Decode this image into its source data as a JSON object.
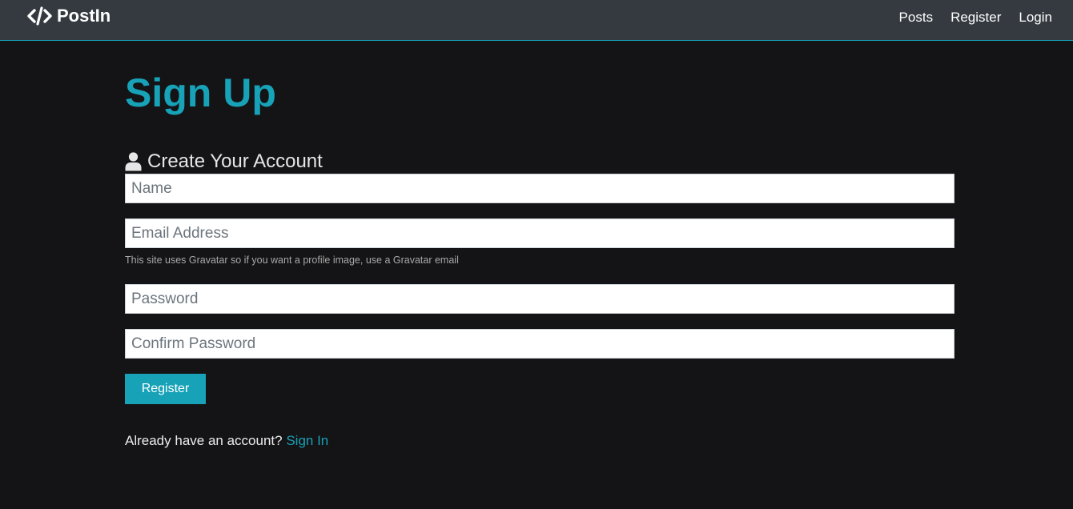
{
  "navbar": {
    "brand": "PostIn",
    "brand_icon": "code-icon",
    "links": [
      "Posts",
      "Register",
      "Login"
    ]
  },
  "main": {
    "title": "Sign Up",
    "lead": "Create Your Account",
    "lead_icon": "user-icon",
    "fields": {
      "name_placeholder": "Name",
      "email_placeholder": "Email Address",
      "email_help": "This site uses Gravatar so if you want a profile image, use a Gravatar email",
      "password_placeholder": "Password",
      "confirm_placeholder": "Confirm Password"
    },
    "submit_label": "Register",
    "signin_prompt": "Already have an account?",
    "signin_link": "Sign In"
  },
  "colors": {
    "accent": "#17a2b8",
    "navbar_bg": "#343a40",
    "page_bg": "#141315"
  }
}
